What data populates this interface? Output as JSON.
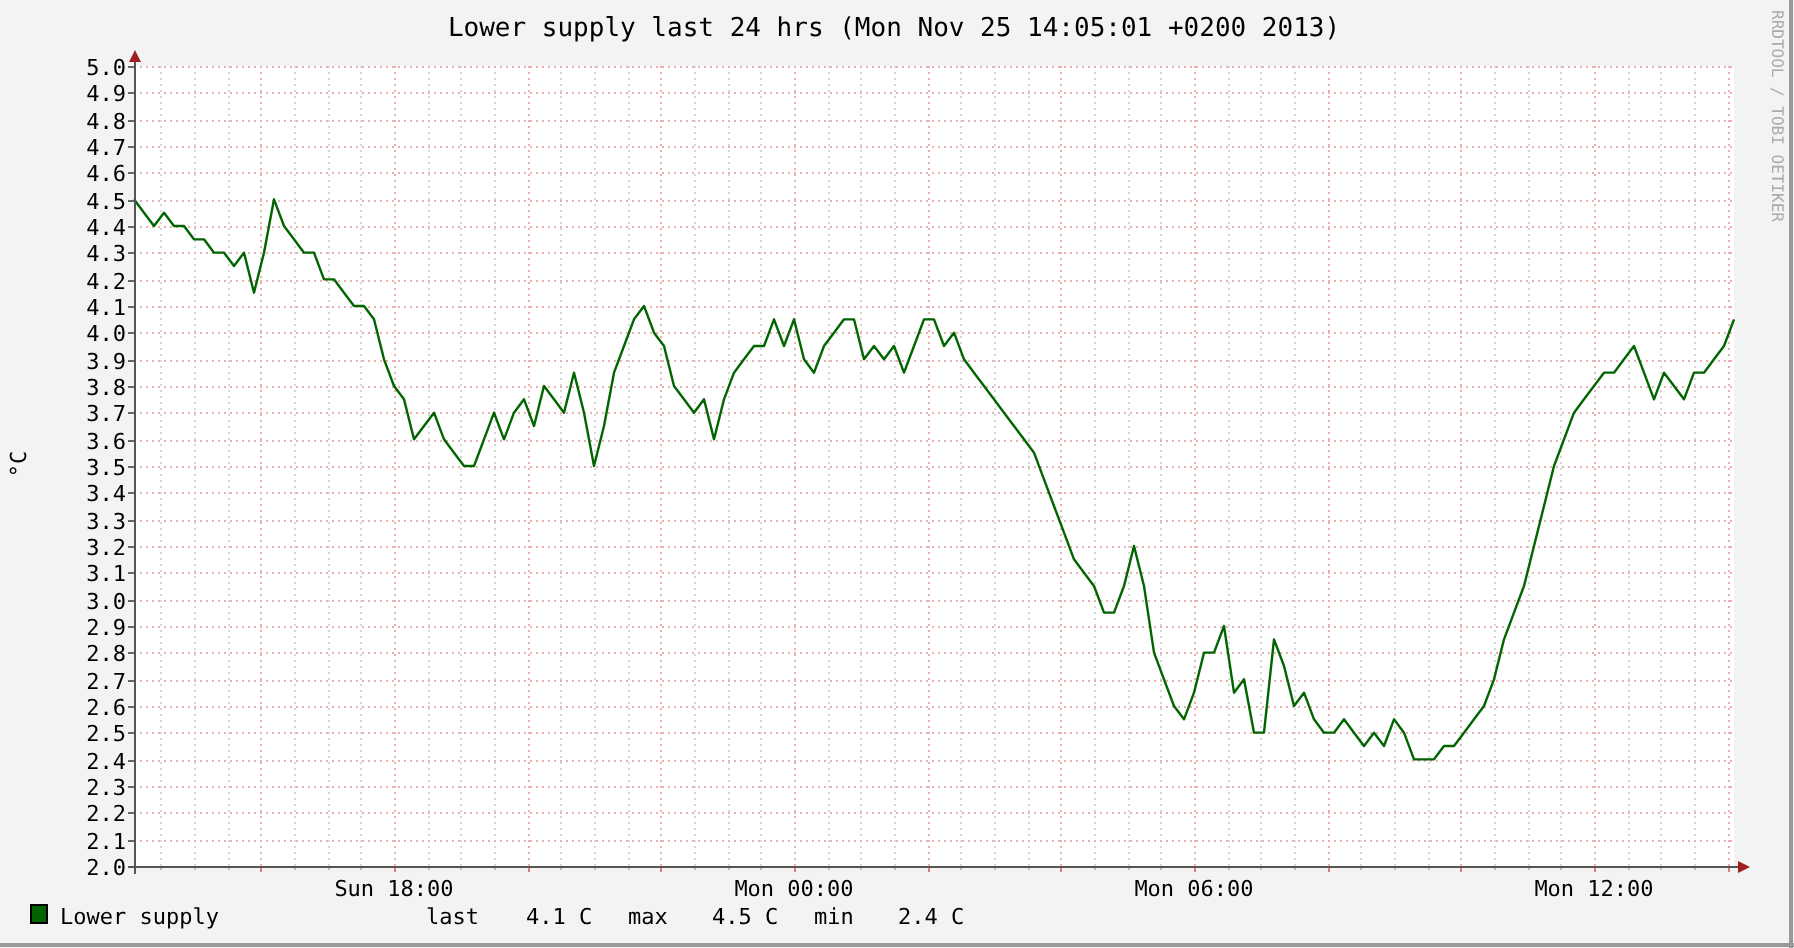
{
  "graph": {
    "credit": "RRDTOOL / TOBI OETIKER",
    "chart_data": {
      "type": "line",
      "title": "Lower supply last 24 hrs (Mon Nov 25 14:05:01 +0200 2013)",
      "ylabel": "°C",
      "categories": [
        null,
        null,
        null,
        null,
        null,
        null,
        null,
        null,
        null,
        null,
        null,
        null,
        null,
        null,
        null,
        null,
        null,
        null,
        null,
        null,
        null,
        null,
        null,
        null,
        null,
        null,
        "Sun 18:00",
        null,
        null,
        null,
        null,
        null,
        null,
        null,
        null,
        null,
        null,
        null,
        null,
        null,
        null,
        null,
        null,
        null,
        null,
        null,
        null,
        null,
        null,
        null,
        null,
        null,
        null,
        null,
        null,
        null,
        null,
        null,
        null,
        null,
        null,
        null,
        null,
        null,
        null,
        null,
        "Mon 00:00",
        null,
        null,
        null,
        null,
        null,
        null,
        null,
        null,
        null,
        null,
        null,
        null,
        null,
        null,
        null,
        null,
        null,
        null,
        null,
        null,
        null,
        null,
        null,
        null,
        null,
        null,
        null,
        null,
        null,
        null,
        null,
        null,
        null,
        null,
        null,
        null,
        null,
        null,
        null,
        "Mon 06:00",
        null,
        null,
        null,
        null,
        null,
        null,
        null,
        null,
        null,
        null,
        null,
        null,
        null,
        null,
        null,
        null,
        null,
        null,
        null,
        null,
        null,
        null,
        null,
        null,
        null,
        null,
        null,
        null,
        null,
        null,
        null,
        null,
        null,
        null,
        null,
        null,
        null,
        null,
        null,
        "Mon 12:00",
        null,
        null,
        null,
        null,
        null,
        null,
        null,
        null,
        null,
        null,
        null,
        null,
        null,
        null
      ],
      "series": [
        {
          "name": "Lower supply",
          "color": "#006400",
          "values": [
            4.5,
            4.45,
            4.4,
            4.45,
            4.4,
            4.4,
            4.35,
            4.35,
            4.3,
            4.3,
            4.25,
            4.3,
            4.15,
            4.3,
            4.5,
            4.4,
            4.35,
            4.3,
            4.3,
            4.2,
            4.2,
            4.15,
            4.1,
            4.1,
            4.05,
            3.9,
            3.8,
            3.75,
            3.6,
            3.65,
            3.7,
            3.6,
            3.55,
            3.5,
            3.5,
            3.6,
            3.7,
            3.6,
            3.7,
            3.75,
            3.65,
            3.8,
            3.75,
            3.7,
            3.85,
            3.7,
            3.5,
            3.65,
            3.85,
            3.95,
            4.05,
            4.1,
            4.0,
            3.95,
            3.8,
            3.75,
            3.7,
            3.75,
            3.6,
            3.75,
            3.85,
            3.9,
            3.95,
            3.95,
            4.05,
            3.95,
            4.05,
            3.9,
            3.85,
            3.95,
            4.0,
            4.05,
            4.05,
            3.9,
            3.95,
            3.9,
            3.95,
            3.85,
            3.95,
            4.05,
            4.05,
            3.95,
            4.0,
            3.9,
            3.85,
            3.8,
            3.75,
            3.7,
            3.65,
            3.6,
            3.55,
            3.45,
            3.35,
            3.25,
            3.15,
            3.1,
            3.05,
            2.95,
            2.95,
            3.05,
            3.2,
            3.05,
            2.8,
            2.7,
            2.6,
            2.55,
            2.65,
            2.8,
            2.8,
            2.9,
            2.65,
            2.7,
            2.5,
            2.5,
            2.85,
            2.75,
            2.6,
            2.65,
            2.55,
            2.5,
            2.5,
            2.55,
            2.5,
            2.45,
            2.5,
            2.45,
            2.55,
            2.5,
            2.4,
            2.4,
            2.4,
            2.45,
            2.45,
            2.5,
            2.55,
            2.6,
            2.7,
            2.85,
            2.95,
            3.05,
            3.2,
            3.35,
            3.5,
            3.6,
            3.7,
            3.75,
            3.8,
            3.85,
            3.85,
            3.9,
            3.95,
            3.85,
            3.75,
            3.85,
            3.8,
            3.75,
            3.85,
            3.85,
            3.9,
            3.95,
            4.05
          ]
        }
      ],
      "ylim": [
        2,
        5
      ],
      "grid": true,
      "yticks": [
        {
          "value": 2,
          "label": "2.0"
        },
        {
          "value": 2.1,
          "label": "2.1"
        },
        {
          "value": 2.2,
          "label": "2.2"
        },
        {
          "value": 2.3,
          "label": "2.3"
        },
        {
          "value": 2.4,
          "label": "2.4"
        },
        {
          "value": 2.5,
          "label": "2.5"
        },
        {
          "value": 2.6,
          "label": "2.6"
        },
        {
          "value": 2.7,
          "label": "2.7"
        },
        {
          "value": 2.8,
          "label": "2.8"
        },
        {
          "value": 2.9,
          "label": "2.9"
        },
        {
          "value": 3,
          "label": "3.0"
        },
        {
          "value": 3.1,
          "label": "3.1"
        },
        {
          "value": 3.2,
          "label": "3.2"
        },
        {
          "value": 3.3,
          "label": "3.3"
        },
        {
          "value": 3.4,
          "label": "3.4"
        },
        {
          "value": 3.5,
          "label": "3.5"
        },
        {
          "value": 3.6,
          "label": "3.6"
        },
        {
          "value": 3.7,
          "label": "3.7"
        },
        {
          "value": 3.8,
          "label": "3.8"
        },
        {
          "value": 3.9,
          "label": "3.9"
        },
        {
          "value": 4,
          "label": "4.0"
        },
        {
          "value": 4.1,
          "label": "4.1"
        },
        {
          "value": 4.2,
          "label": "4.2"
        },
        {
          "value": 4.3,
          "label": "4.3"
        },
        {
          "value": 4.4,
          "label": "4.4"
        },
        {
          "value": 4.5,
          "label": "4.5"
        },
        {
          "value": 4.6,
          "label": "4.6"
        },
        {
          "value": 4.7,
          "label": "4.7"
        },
        {
          "value": 4.8,
          "label": "4.8"
        },
        {
          "value": 4.9,
          "label": "4.9"
        },
        {
          "value": 5,
          "label": "5.0"
        }
      ]
    },
    "legend": {
      "stats": [
        {
          "label": "last",
          "value": "4.1 C"
        },
        {
          "label": "max",
          "value": "4.5 C"
        },
        {
          "label": "min",
          "value": "2.4 C"
        }
      ]
    }
  }
}
